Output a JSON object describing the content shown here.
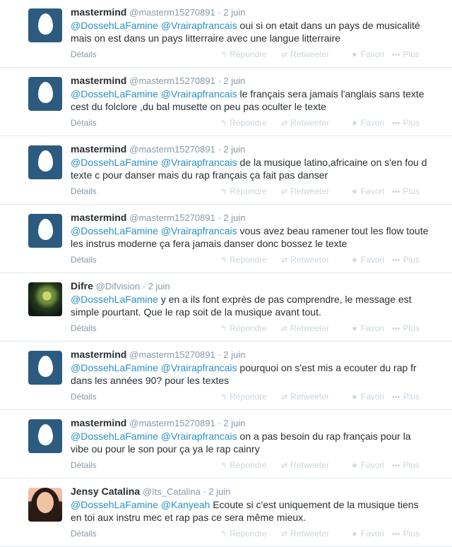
{
  "labels": {
    "details": "Détails",
    "reply": "Répondre",
    "retweet": "Retweeter",
    "favorite": "Favori",
    "more": "Plus"
  },
  "icons": {
    "reply": "reply-icon",
    "retweet": "retweet-icon",
    "favorite": "star-icon",
    "more": "more-dots-icon"
  },
  "tweets": [
    {
      "name": "mastermind",
      "handle": "@masterm15270891",
      "time": "2 juin",
      "avatar": "egg",
      "mentions": [
        "@DossehLaFamine",
        "@Vrairapfrancais"
      ],
      "text": " oui si on etait dans un pays de musicalité mais on est dans un pays litterraire avec une langue litterraire"
    },
    {
      "name": "mastermind",
      "handle": "@masterm15270891",
      "time": "2 juin",
      "avatar": "egg",
      "mentions": [
        "@DossehLaFamine",
        "@Vrairapfrancais"
      ],
      "text": "  le français sera jamais l'anglais sans texte cest du folclore ,du bal musette on peu pas oculter le texte"
    },
    {
      "name": "mastermind",
      "handle": "@masterm15270891",
      "time": "2 juin",
      "avatar": "egg",
      "mentions": [
        "@DossehLaFamine",
        "@Vrairapfrancais"
      ],
      "text": "  de la musique latino,africaine on s'en fou d texte c pour danser mais du rap français ça fait pas danser"
    },
    {
      "name": "mastermind",
      "handle": "@masterm15270891",
      "time": "2 juin",
      "avatar": "egg",
      "mentions": [
        "@DossehLaFamine",
        "@Vrairapfrancais"
      ],
      "text": "  vous avez beau ramener tout les flow toute les instrus moderne ça fera jamais danser donc bossez le texte"
    },
    {
      "name": "Difre",
      "handle": "@Difvision",
      "time": "2 juin",
      "avatar": "difre",
      "mentions": [
        "@DossehLaFamine"
      ],
      "text": " y en a ils font exprès de pas comprendre, le message est simple pourtant. Que le rap soit de la musique avant tout."
    },
    {
      "name": "mastermind",
      "handle": "@masterm15270891",
      "time": "2 juin",
      "avatar": "egg",
      "mentions": [
        "@DossehLaFamine",
        "@Vrairapfrancais"
      ],
      "text": "  pourquoi on s'est mis a ecouter du rap fr dans les années 90? pour les textes"
    },
    {
      "name": "mastermind",
      "handle": "@masterm15270891",
      "time": "2 juin",
      "avatar": "egg",
      "mentions": [
        "@DossehLaFamine",
        "@Vrairapfrancais"
      ],
      "text": " on a pas besoin du rap français pour la vibe ou pour le son  pour ça ya le rap cainry"
    },
    {
      "name": "Jensy Catalina",
      "handle": "@Its_Catalina",
      "time": "2 juin",
      "avatar": "jensy",
      "mentions": [
        "@DossehLaFamine",
        "@Kanyeah"
      ],
      "text": " Ecoute si c'est uniquement de la musique tiens en toi aux instru mec et rap pas ce sera même mieux."
    }
  ]
}
